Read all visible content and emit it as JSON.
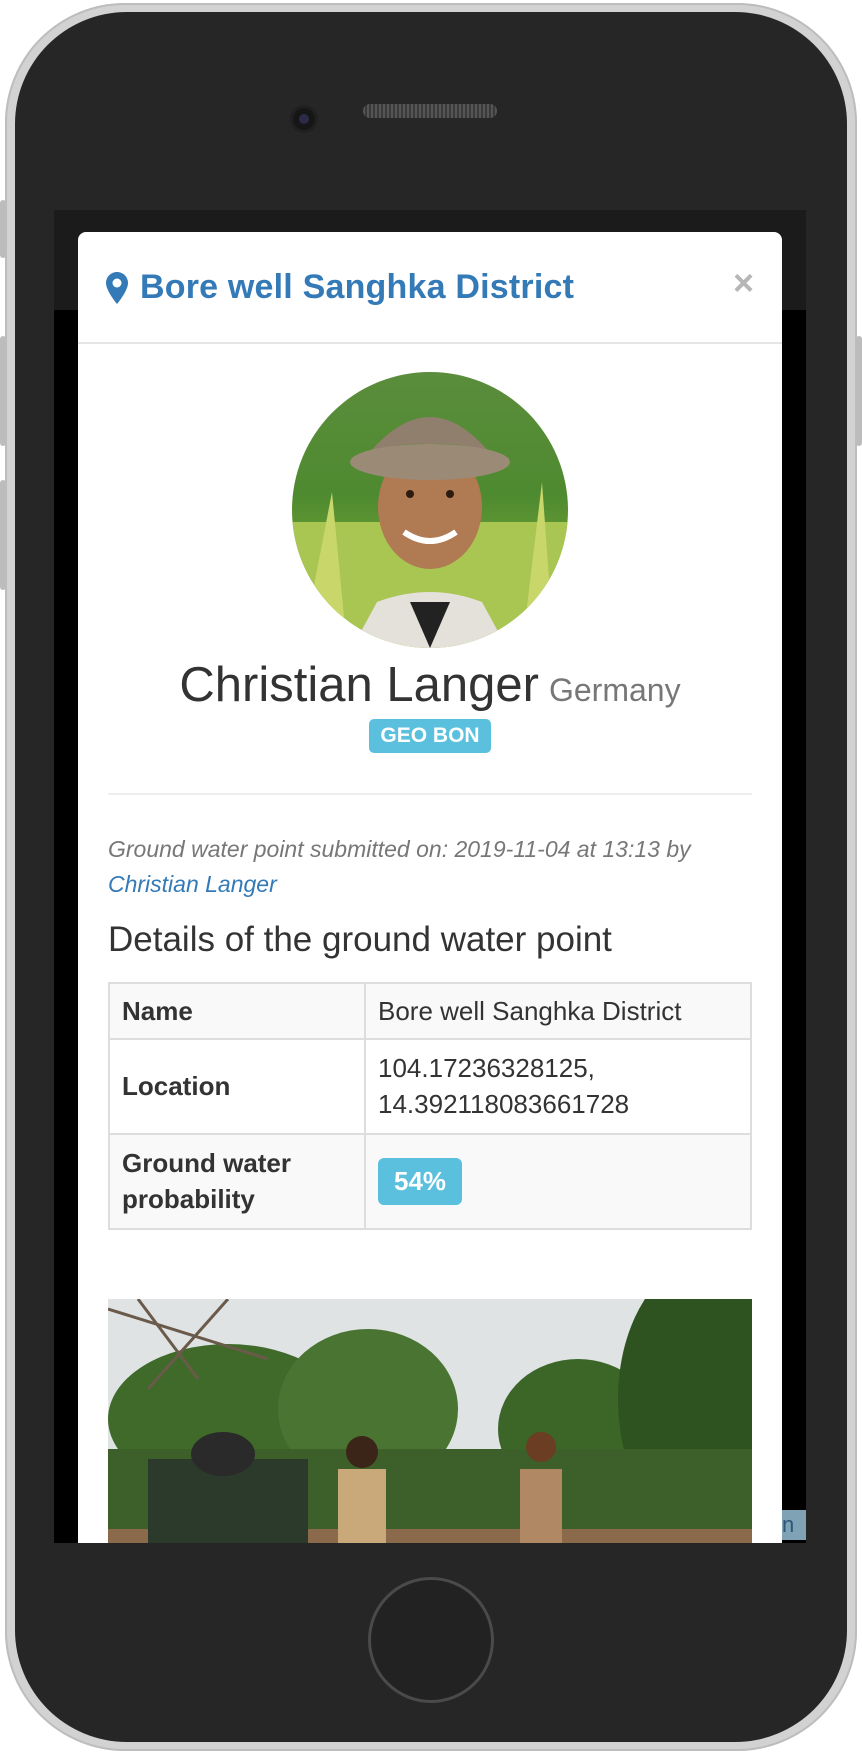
{
  "modal": {
    "title": "Bore well Sanghka District",
    "close_symbol": "×",
    "person": {
      "name": "Christian Langer",
      "country": "Germany",
      "badge": "GEO BON"
    },
    "submitted": {
      "text": "Ground water point submitted on: 2019-11-04 at 13:13 by",
      "author_link": "Christian Langer"
    },
    "details_title": "Details of the ground water point",
    "details": [
      {
        "key": "Name",
        "value": "Bore well Sanghka District"
      },
      {
        "key": "Location",
        "value": "104.17236328125, 14.392118083661728"
      },
      {
        "key": "Ground water probability",
        "value": "54%"
      }
    ]
  },
  "carousel": {
    "prev_symbol": "‹",
    "next_symbol": "›"
  },
  "icons": {
    "title_icon": "map-marker-icon"
  },
  "colors": {
    "link": "#337ab7",
    "badge": "#5bc0de",
    "text": "#333333",
    "muted": "#777777"
  }
}
